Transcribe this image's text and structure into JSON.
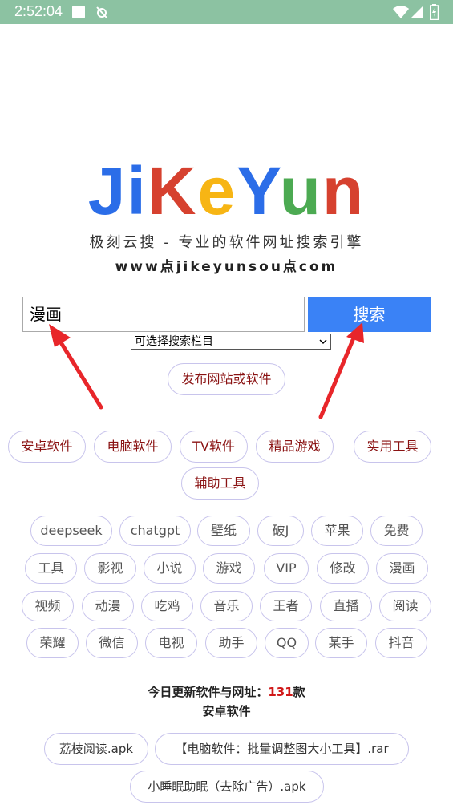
{
  "status_bar": {
    "time": "2:52:04"
  },
  "logo": {
    "letters": [
      {
        "ch": "J",
        "color": "#2b6de8"
      },
      {
        "ch": "i",
        "color": "#2b6de8"
      },
      {
        "ch": "K",
        "color": "#d6412f"
      },
      {
        "ch": "e",
        "color": "#f7b514"
      },
      {
        "ch": "Y",
        "color": "#2b6de8"
      },
      {
        "ch": "u",
        "color": "#4caa52"
      },
      {
        "ch": "n",
        "color": "#d6412f"
      }
    ]
  },
  "subtitle": "极刻云搜 - 专业的软件网址搜索引擎",
  "domain": "www点jikeyunsou点com",
  "search": {
    "value": "漫画",
    "button": "搜索",
    "select": "可选择搜索栏目"
  },
  "publish_button": "发布网站或软件",
  "categories": [
    "安卓软件",
    "电脑软件",
    "TV软件",
    "精品游戏",
    "实用工具",
    "辅助工具"
  ],
  "tags": [
    "deepseek",
    "chatgpt",
    "壁纸",
    "破J",
    "苹果",
    "免费",
    "工具",
    "影视",
    "小说",
    "游戏",
    "VIP",
    "修改",
    "漫画",
    "视频",
    "动漫",
    "吃鸡",
    "音乐",
    "王者",
    "直播",
    "阅读",
    "荣耀",
    "微信",
    "电视",
    "助手",
    "QQ",
    "某手",
    "抖音"
  ],
  "stats": {
    "label": "今日更新软件与网址：",
    "count": "131",
    "unit": "款",
    "section": "安卓软件"
  },
  "files": [
    "荔枝阅读.apk",
    "【电脑软件：批量调整图大小工具】.rar",
    "小睡眠助眠（去除广告）.apk"
  ],
  "colors": {
    "accent": "#3a82f6",
    "status_bar": "#8cc2a2",
    "arrow": "#e8262a"
  }
}
